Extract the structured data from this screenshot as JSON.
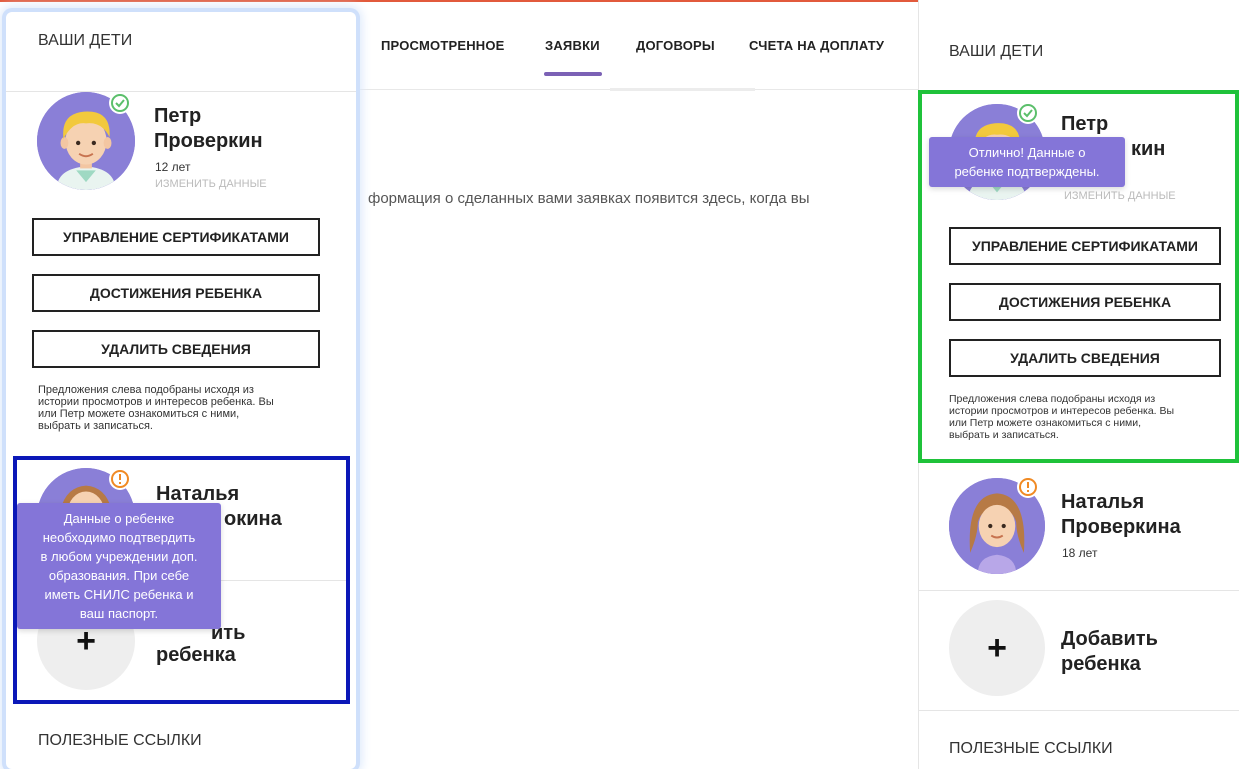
{
  "tabs": [
    {
      "label": "ПРОСМОТРЕННОЕ",
      "active": false
    },
    {
      "label": "ЗАЯВКИ",
      "active": true
    },
    {
      "label": "ДОГОВОРЫ",
      "active": false
    },
    {
      "label": "СЧЕТА НА ДОПЛАТУ",
      "active": false
    }
  ],
  "center_message": "формация о сделанных вами заявках появится здесь, когда вы",
  "accent_color": "#7b61b5",
  "tooltip_color": "#8475d8",
  "left_panel": {
    "heading": "ВАШИ ДЕТИ",
    "child1": {
      "name_line1": "Петр",
      "name_line2": "Проверкин",
      "age": "12 лет",
      "edit": "ИЗМЕНИТЬ ДАННЫЕ",
      "status_icon": "check-circle-icon"
    },
    "buttons": {
      "certificates": "УПРАВЛЕНИЕ СЕРТИФИКАТАМИ",
      "achievements": "ДОСТИЖЕНИЯ РЕБЕНКА",
      "delete": "УДАЛИТЬ СВЕДЕНИЯ"
    },
    "hint_lines": [
      "Предложения слева подобраны исходя из",
      "истории просмотров и интересов ребенка. Вы",
      "или Петр можете ознакомиться с ними,",
      "выбрать и записаться."
    ],
    "child2": {
      "name_line1": "Наталья",
      "name_line2_visible": "окина",
      "status_icon": "warning-circle-icon"
    },
    "tooltip_lines": [
      "Данные о ребенке",
      "необходимо подтвердить",
      "в любом учреждении доп.",
      "образования. При себе",
      "иметь СНИЛС ребенка и",
      "ваш паспорт."
    ],
    "add_line1_visible": "ить",
    "add_line2": "ребенка",
    "add_symbol": "+",
    "links_heading": "ПОЛЕЗНЫЕ ССЫЛКИ"
  },
  "right_panel": {
    "heading": "ВАШИ ДЕТИ",
    "child1": {
      "name_line1": "Петр",
      "name_line2_visible": "кин",
      "edit_visible": "ИЗМЕНИТЬ ДАННЫЕ",
      "status_icon": "check-circle-icon"
    },
    "tooltip_lines": [
      "Отлично! Данные о",
      "ребенке подтверждены."
    ],
    "buttons": {
      "certificates": "УПРАВЛЕНИЕ СЕРТИФИКАТАМИ",
      "achievements": "ДОСТИЖЕНИЯ РЕБЕНКА",
      "delete": "УДАЛИТЬ СВЕДЕНИЯ"
    },
    "hint_lines": [
      "Предложения слева подобраны исходя из",
      "истории просмотров и интересов ребенка. Вы",
      "или Петр можете ознакомиться с ними,",
      "выбрать и записаться."
    ],
    "child2": {
      "name_line1": "Наталья",
      "name_line2": "Проверкина",
      "age": "18 лет",
      "status_icon": "warning-circle-icon"
    },
    "add_symbol": "+",
    "add_line1": "Добавить",
    "add_line2": "ребенка",
    "links_heading": "ПОЛЕЗНЫЕ ССЫЛКИ"
  }
}
